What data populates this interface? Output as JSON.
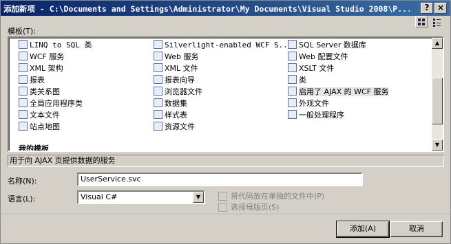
{
  "window": {
    "title": "添加新项 - C:\\Documents and Settings\\Administrator\\My Documents\\Visual Studio 2008\\P...",
    "help_glyph": "?",
    "close_glyph": "×"
  },
  "templates_label": "模板(T):",
  "templates_label_key": "T",
  "items_col1": [
    {
      "label": "LINQ to SQL 类",
      "icon": "linq-icon"
    },
    {
      "label": "WCF 服务",
      "icon": "wcf-icon"
    },
    {
      "label": "XML 架构",
      "icon": "xml-schema-icon"
    },
    {
      "label": "报表",
      "icon": "report-icon"
    },
    {
      "label": "类关系图",
      "icon": "class-diagram-icon"
    },
    {
      "label": "全局应用程序类",
      "icon": "global-icon"
    },
    {
      "label": "文本文件",
      "icon": "text-file-icon"
    },
    {
      "label": "站点地图",
      "icon": "sitemap-icon"
    }
  ],
  "items_col2": [
    {
      "label": "Silverlight-enabled WCF S...",
      "icon": "silverlight-icon"
    },
    {
      "label": "Web 服务",
      "icon": "web-service-icon"
    },
    {
      "label": "XML 文件",
      "icon": "xml-file-icon"
    },
    {
      "label": "报表向导",
      "icon": "report-wizard-icon"
    },
    {
      "label": "浏览器文件",
      "icon": "browser-file-icon"
    },
    {
      "label": "数据集",
      "icon": "dataset-icon"
    },
    {
      "label": "样式表",
      "icon": "stylesheet-icon"
    },
    {
      "label": "资源文件",
      "icon": "resource-file-icon"
    }
  ],
  "items_col3": [
    {
      "label": "SQL Server 数据库",
      "icon": "database-icon"
    },
    {
      "label": "Web 配置文件",
      "icon": "web-config-icon"
    },
    {
      "label": "XSLT 文件",
      "icon": "xslt-icon"
    },
    {
      "label": "类",
      "icon": "class-icon"
    },
    {
      "label": "启用了 AJAX 的 WCF 服务",
      "icon": "ajax-wcf-icon",
      "selected": true
    },
    {
      "label": "外观文件",
      "icon": "skin-file-icon"
    },
    {
      "label": "一般处理程序",
      "icon": "handler-icon"
    }
  ],
  "my_templates_header": "我的模板",
  "description": "用于向 AJAX 页提供数据的服务",
  "name_label": "名称(N):",
  "name_value": "UserService.svc",
  "language_label": "语言(L):",
  "language_value": "Visual C#",
  "checkbox_separate": "将代码放在单独的文件中(P)",
  "checkbox_master": "选择母版页(S)",
  "add_button": "添加(A)",
  "cancel_button": "取消",
  "colors": {
    "titlebar_start": "#0a246a",
    "titlebar_end": "#3a6ea5",
    "dialog_bg": "#d4d0c8",
    "selection_bg": "#e6e6e6"
  }
}
